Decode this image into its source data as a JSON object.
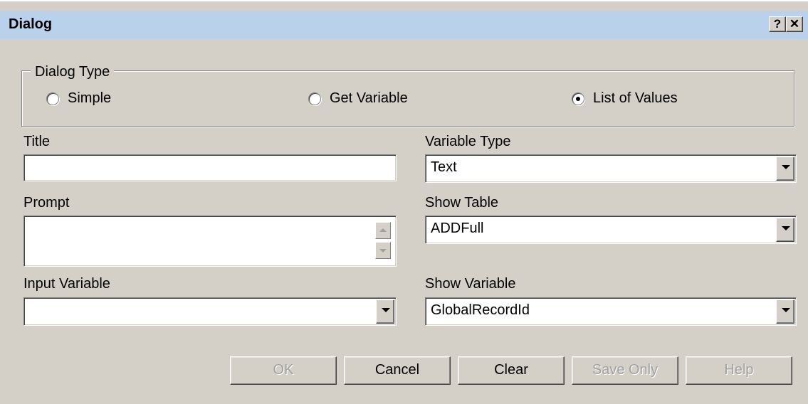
{
  "window": {
    "title": "Dialog"
  },
  "caption_buttons": {
    "help": "?",
    "close": "✕"
  },
  "dialog_type": {
    "legend": "Dialog Type",
    "options": [
      {
        "label": "Simple",
        "checked": false
      },
      {
        "label": "Get Variable",
        "checked": false
      },
      {
        "label": "List of Values",
        "checked": true
      }
    ]
  },
  "fields": {
    "title": {
      "label": "Title",
      "value": ""
    },
    "prompt": {
      "label": "Prompt",
      "value": ""
    },
    "input_variable": {
      "label": "Input Variable",
      "value": ""
    },
    "variable_type": {
      "label": "Variable Type",
      "value": "Text"
    },
    "show_table": {
      "label": "Show Table",
      "value": "ADDFull"
    },
    "show_variable": {
      "label": "Show Variable",
      "value": "GlobalRecordId"
    }
  },
  "buttons": {
    "ok": {
      "label": "OK",
      "enabled": false
    },
    "cancel": {
      "label": "Cancel",
      "enabled": true
    },
    "clear": {
      "label": "Clear",
      "enabled": true
    },
    "save_only": {
      "label": "Save Only",
      "enabled": false
    },
    "help": {
      "label": "Help",
      "enabled": false
    }
  },
  "icons": {
    "dropdown": "chevron-down-icon",
    "scroll_up": "arrow-up-icon",
    "scroll_down": "arrow-down-icon"
  }
}
